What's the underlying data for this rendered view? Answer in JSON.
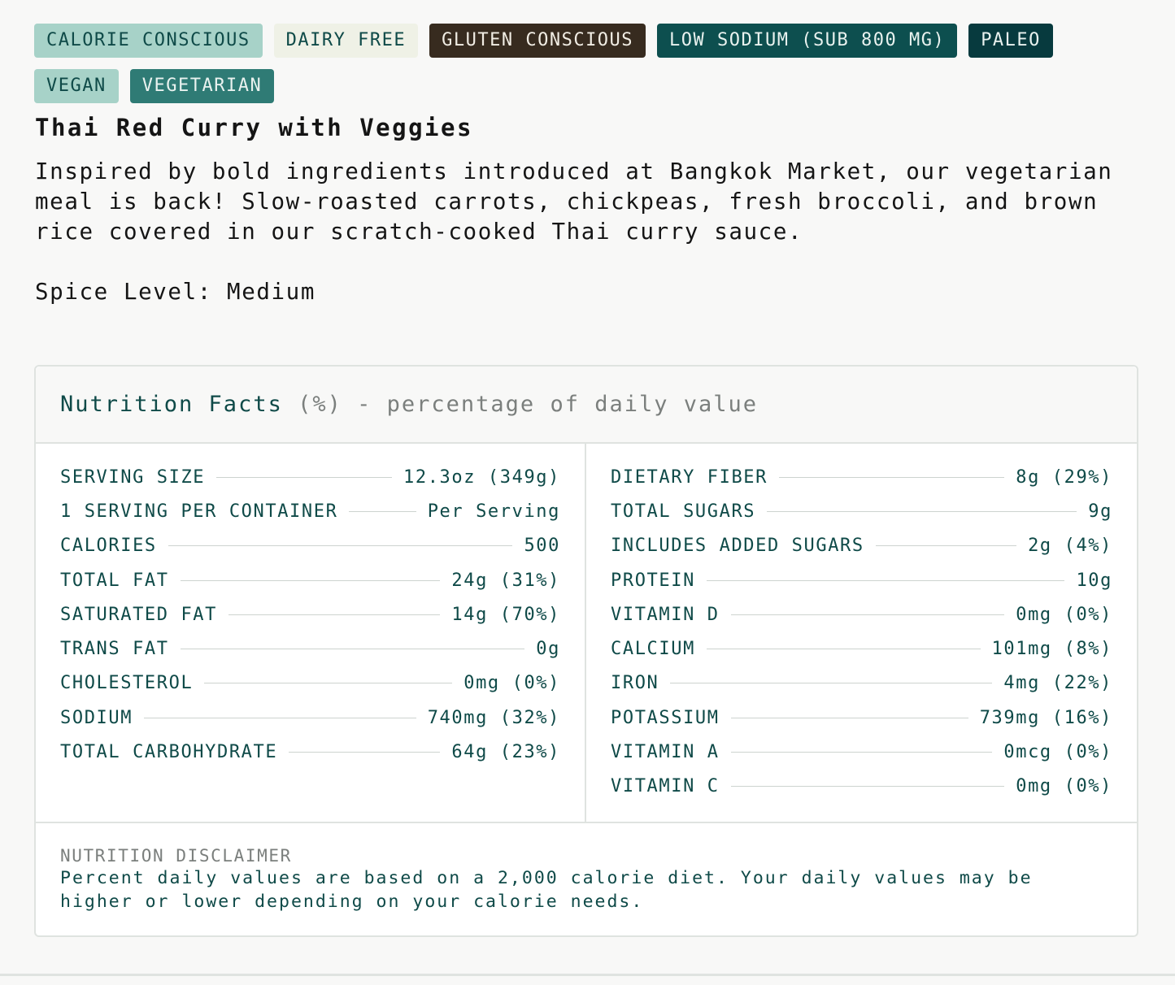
{
  "tags": [
    {
      "label": "CALORIE CONSCIOUS",
      "color": "#a7d2c8"
    },
    {
      "label": "DAIRY FREE",
      "color": "#eff1e6"
    },
    {
      "label": "GLUTEN CONSCIOUS",
      "color": "#372b1f"
    },
    {
      "label": "LOW SODIUM (SUB 800 MG)",
      "color": "#0d4f4f"
    },
    {
      "label": "PALEO",
      "color": "#073a3e"
    },
    {
      "label": "VEGAN",
      "color": "#a7d2c8"
    },
    {
      "label": "VEGETARIAN",
      "color": "#2f7b75"
    }
  ],
  "meal": {
    "title": "Thai Red Curry with Veggies",
    "description": "Inspired by bold ingredients introduced at Bangkok Market, our vegetarian meal is back! Slow-roasted carrots, chickpeas, fresh broccoli, and brown rice covered in our scratch-cooked Thai curry sauce.",
    "spice_level": "Spice Level: Medium"
  },
  "nutrition": {
    "header_main": "Nutrition Facts",
    "header_sub": " (%) - percentage of daily value",
    "left": [
      {
        "label": "SERVING SIZE",
        "value": "12.3oz (349g)"
      },
      {
        "label": "1 SERVING PER CONTAINER",
        "value": "Per Serving"
      },
      {
        "label": "CALORIES",
        "value": "500"
      },
      {
        "label": "TOTAL FAT",
        "value": "24g (31%)"
      },
      {
        "label": "SATURATED FAT",
        "value": "14g (70%)"
      },
      {
        "label": "TRANS FAT",
        "value": "0g"
      },
      {
        "label": "CHOLESTEROL",
        "value": "0mg (0%)"
      },
      {
        "label": "SODIUM",
        "value": "740mg (32%)"
      },
      {
        "label": "TOTAL CARBOHYDRATE",
        "value": "64g (23%)"
      }
    ],
    "right": [
      {
        "label": "DIETARY FIBER",
        "value": "8g (29%)"
      },
      {
        "label": "TOTAL SUGARS",
        "value": "9g"
      },
      {
        "label": "INCLUDES ADDED SUGARS",
        "value": "2g (4%)"
      },
      {
        "label": "PROTEIN",
        "value": "10g"
      },
      {
        "label": "VITAMIN D",
        "value": "0mg (0%)"
      },
      {
        "label": "CALCIUM",
        "value": "101mg (8%)"
      },
      {
        "label": "IRON",
        "value": "4mg (22%)"
      },
      {
        "label": "POTASSIUM",
        "value": "739mg (16%)"
      },
      {
        "label": "VITAMIN A",
        "value": "0mcg (0%)"
      },
      {
        "label": "VITAMIN C",
        "value": "0mg (0%)"
      }
    ],
    "disclaimer_title": "NUTRITION DISCLAIMER",
    "disclaimer_text": "Percent daily values are based on a 2,000 calorie diet. Your daily values may be higher or lower depending on your calorie needs."
  }
}
